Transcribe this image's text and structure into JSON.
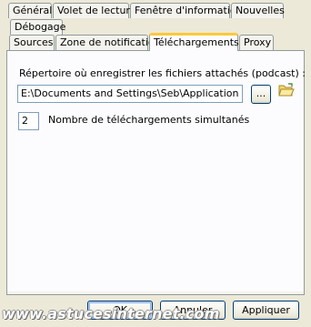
{
  "tabs_row1": [
    {
      "label": "Général"
    },
    {
      "label": "Volet de lecture"
    },
    {
      "label": "Fenêtre d'information"
    },
    {
      "label": "Nouvelles"
    },
    {
      "label": "Débogage"
    }
  ],
  "tabs_row2": [
    {
      "label": "Sources"
    },
    {
      "label": "Zone de notification"
    },
    {
      "label": "Téléchargements"
    },
    {
      "label": "Proxy"
    }
  ],
  "active_tab": "Téléchargements",
  "downloads": {
    "directory_label": "Répertoire où enregistrer les fichiers attachés (podcast) :",
    "directory_value": "E:\\Documents and Settings\\Seb\\Application Data",
    "browse_label": "...",
    "folder_icon": "folder-open-icon",
    "simultaneous_value": "2",
    "simultaneous_label": "Nombre de téléchargements simultanés"
  },
  "buttons": {
    "ok": "OK",
    "cancel": "Annuler",
    "apply": "Appliquer"
  },
  "watermark": "www.astucesinternet.com"
}
